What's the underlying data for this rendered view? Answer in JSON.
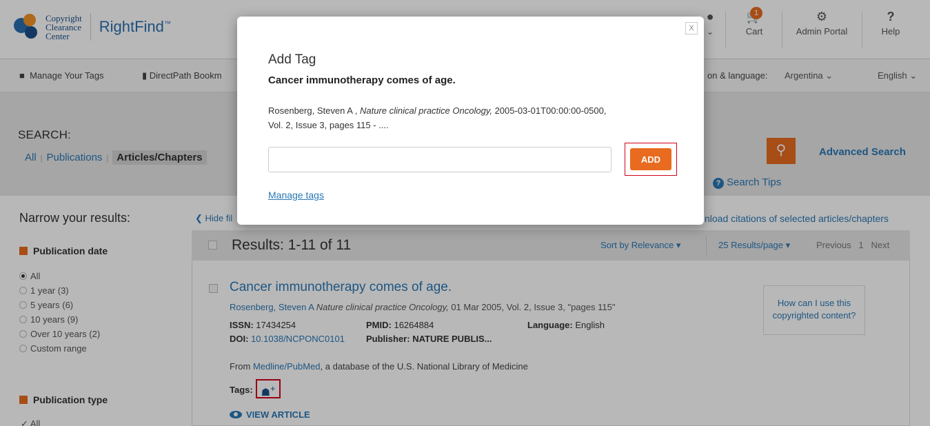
{
  "header": {
    "logo_lines": [
      "Copyright",
      "Clearance",
      "Center"
    ],
    "product_name": "RightFind",
    "product_mark": "™",
    "cart_label": "Cart",
    "cart_count": "1",
    "admin_label": "Admin Portal",
    "help_label": "Help",
    "help_symbol": "?"
  },
  "subnav": {
    "manage_tags": "Manage Your Tags",
    "bookmarks": "DirectPath Bookm",
    "region_label": "on & language:",
    "region_value": "Argentina",
    "language_value": "English"
  },
  "search": {
    "label": "SEARCH:",
    "tabs": [
      "All",
      "Publications",
      "Articles/Chapters"
    ],
    "active_tab": "Articles/Chapters",
    "advanced_search": "Advanced Search",
    "search_tips": "Search Tips"
  },
  "sidebar": {
    "heading": "Narrow your results:",
    "publication_date": {
      "label": "Publication date",
      "options": [
        "All",
        "1 year (3)",
        "5 years (6)",
        "10 years (9)",
        "Over 10 years (2)",
        "Custom range"
      ],
      "selected": "All"
    },
    "publication_type": {
      "label": "Publication type",
      "first_option": "All"
    }
  },
  "results": {
    "hide_filters": "Hide fil",
    "download_citations": "nload citations of selected articles/chapters",
    "title": "Results: 1-11 of 11",
    "sort_label": "Sort by Relevance",
    "per_page": "25 Results/page",
    "pager": [
      "Previous",
      "1",
      "Next"
    ],
    "items": [
      {
        "title": "Cancer immunotherapy comes of age.",
        "author": "Rosenberg, Steven A",
        "journal": "Nature clinical practice Oncology,",
        "details": "01 Mar 2005, Vol. 2, Issue 3, \"pages 115\"",
        "issn_label": "ISSN:",
        "issn": "17434254",
        "pmid_label": "PMID:",
        "pmid": "16264884",
        "language_label": "Language:",
        "language": "English",
        "doi_label": "DOI:",
        "doi": "10.1038/NCPONC0101",
        "publisher_label": "Publisher:",
        "publisher": "NATURE PUBLIS...",
        "from_prefix": "From",
        "from_source": "Medline/PubMed",
        "from_suffix": ", a database of the U.S. National Library of Medicine",
        "tags_label": "Tags:",
        "view_article": "VIEW ARTICLE",
        "usage_prompt": "How can I use this copyrighted content?"
      }
    ]
  },
  "modal": {
    "close": "X",
    "heading": "Add Tag",
    "article_title": "Cancer immunotherapy comes of age.",
    "cite_authors": "Rosenberg, Steven A ,",
    "cite_journal": "Nature clinical practice Oncology,",
    "cite_rest": "2005-03-01T00:00:00-0500,",
    "cite_line2": "Vol. 2, Issue 3, pages 115 - ....",
    "input_value": "",
    "input_placeholder": "",
    "add_label": "ADD",
    "manage_tags": "Manage tags"
  },
  "colors": {
    "accent": "#e86b1f",
    "link": "#2a78b5",
    "highlight_outline": "#d0021b"
  },
  "icons": [
    "user-icon",
    "cart-icon",
    "gear-icon",
    "help-icon",
    "lock-icon",
    "bookmark-icon",
    "search-icon",
    "question-circle-icon",
    "chevron-left-icon",
    "caret-down-icon",
    "eye-icon",
    "tag-add-icon",
    "close-icon"
  ]
}
